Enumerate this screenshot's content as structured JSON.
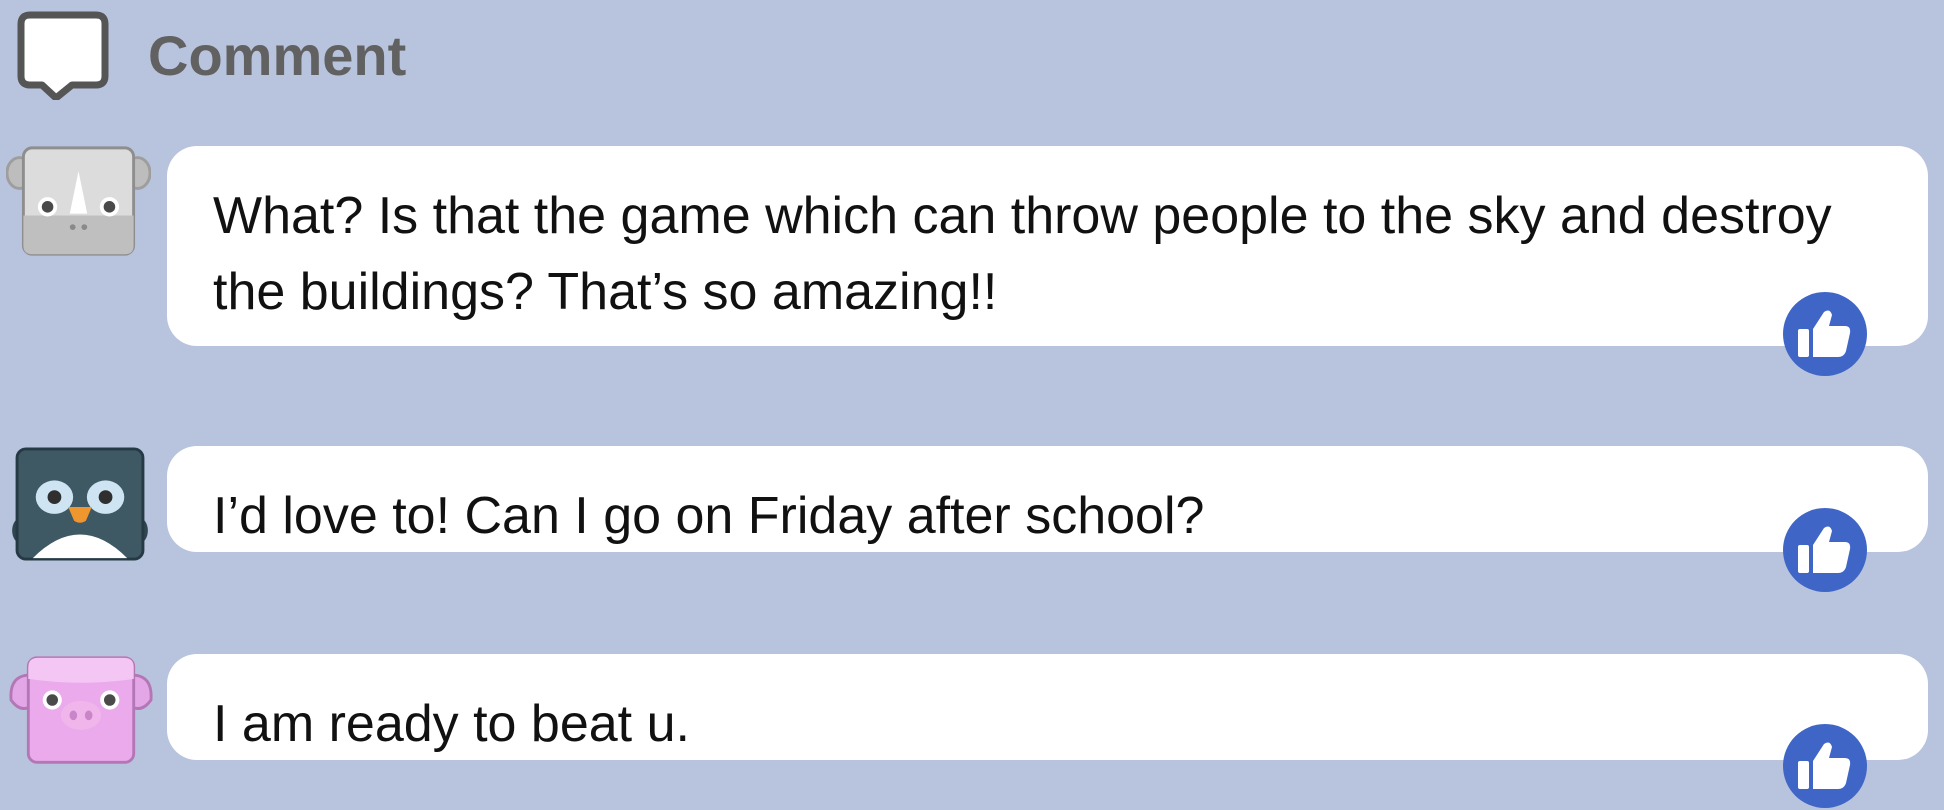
{
  "header": {
    "title": "Comment",
    "icon": "comment-bubble-icon"
  },
  "comments": [
    {
      "avatar": "rhino-avatar",
      "text": "What? Is that the game which can throw people to the sky and destroy the buildings? That’s so amazing!!",
      "like_icon": "thumbs-up-icon"
    },
    {
      "avatar": "penguin-avatar",
      "text": "I’d love to! Can I go on Friday after school?",
      "like_icon": "thumbs-up-icon"
    },
    {
      "avatar": "pig-avatar",
      "text": "I am ready to beat u.",
      "like_icon": "thumbs-up-icon"
    }
  ],
  "colors": {
    "background": "#b8c4dd",
    "bubble": "#ffffff",
    "like_button": "#3f66c6",
    "header_text": "#616161"
  }
}
